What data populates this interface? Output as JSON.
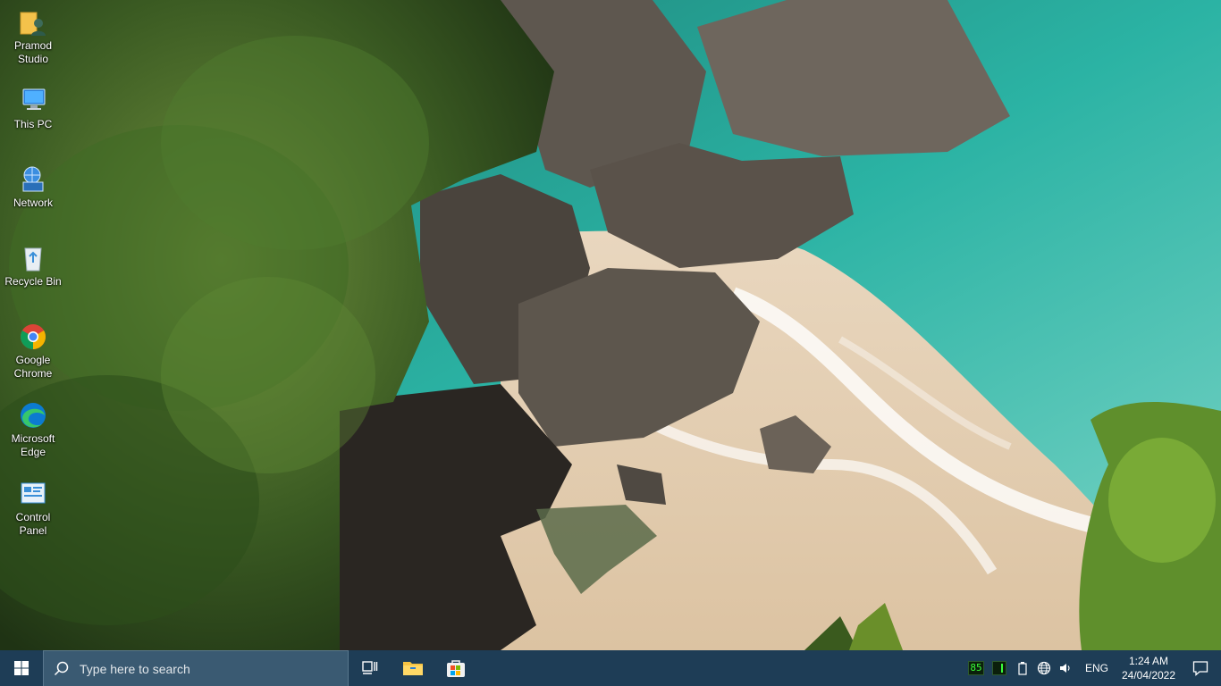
{
  "desktop": {
    "icons": [
      {
        "label": "Pramod\nStudio",
        "icon": "user-folder-icon"
      },
      {
        "label": "This PC",
        "icon": "computer-icon"
      },
      {
        "label": "Network",
        "icon": "network-icon"
      },
      {
        "label": "Recycle Bin",
        "icon": "recycle-bin-icon"
      },
      {
        "label": "Google\nChrome",
        "icon": "chrome-icon"
      },
      {
        "label": "Microsoft\nEdge",
        "icon": "edge-icon"
      },
      {
        "label": "Control\nPanel",
        "icon": "control-panel-icon"
      }
    ]
  },
  "taskbar": {
    "search_placeholder": "Type here to search",
    "pinned": [
      {
        "name": "task-view",
        "icon": "task-view-icon"
      },
      {
        "name": "file-explorer",
        "icon": "folder-icon"
      },
      {
        "name": "microsoft-store",
        "icon": "store-icon"
      }
    ],
    "tray": {
      "meter_value": "85",
      "language": "ENG",
      "time": "1:24 AM",
      "date": "24/04/2022"
    }
  },
  "colors": {
    "taskbar_bg": "#1e3d56",
    "search_bg": "#3a5a72",
    "sea": "#27a89a",
    "sand": "#e7cfae",
    "foliage": "#2f4a1e"
  }
}
